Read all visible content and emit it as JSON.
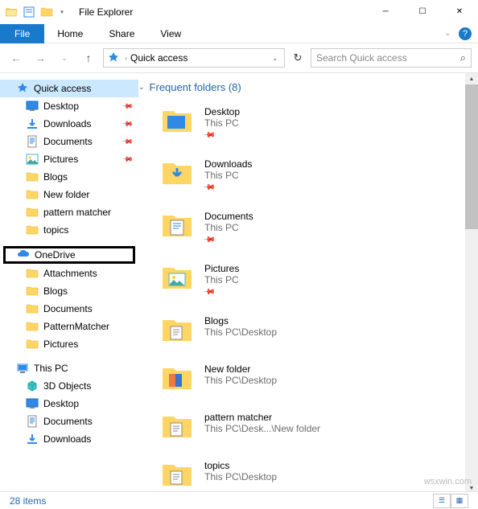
{
  "window": {
    "title": "File Explorer"
  },
  "ribbon": {
    "file": "File",
    "home": "Home",
    "share": "Share",
    "view": "View"
  },
  "address": {
    "location": "Quick access"
  },
  "search": {
    "placeholder": "Search Quick access"
  },
  "sidebar": {
    "quick_access": "Quick access",
    "items_pinned": [
      {
        "label": "Desktop",
        "icon": "desktop"
      },
      {
        "label": "Downloads",
        "icon": "downloads"
      },
      {
        "label": "Documents",
        "icon": "documents"
      },
      {
        "label": "Pictures",
        "icon": "pictures"
      }
    ],
    "items_unpinned": [
      {
        "label": "Blogs"
      },
      {
        "label": "New folder"
      },
      {
        "label": "pattern matcher"
      },
      {
        "label": "topics"
      }
    ],
    "onedrive": "OneDrive",
    "onedrive_items": [
      {
        "label": "Attachments"
      },
      {
        "label": "Blogs"
      },
      {
        "label": "Documents"
      },
      {
        "label": "PatternMatcher"
      },
      {
        "label": "Pictures"
      }
    ],
    "thispc": "This PC",
    "thispc_items": [
      {
        "label": "3D Objects",
        "icon": "3d"
      },
      {
        "label": "Desktop",
        "icon": "desktop"
      },
      {
        "label": "Documents",
        "icon": "documents"
      },
      {
        "label": "Downloads",
        "icon": "downloads"
      }
    ]
  },
  "content": {
    "section_title": "Frequent folders (8)",
    "folders": [
      {
        "name": "Desktop",
        "path": "This PC",
        "pinned": true,
        "icon": "desktop-big"
      },
      {
        "name": "Downloads",
        "path": "This PC",
        "pinned": true,
        "icon": "downloads-big"
      },
      {
        "name": "Documents",
        "path": "This PC",
        "pinned": true,
        "icon": "documents-big"
      },
      {
        "name": "Pictures",
        "path": "This PC",
        "pinned": true,
        "icon": "pictures-big"
      },
      {
        "name": "Blogs",
        "path": "This PC\\Desktop",
        "pinned": false,
        "icon": "folder-docs"
      },
      {
        "name": "New folder",
        "path": "This PC\\Desktop",
        "pinned": false,
        "icon": "folder-color"
      },
      {
        "name": "pattern matcher",
        "path": "This PC\\Desk...\\New folder",
        "pinned": false,
        "icon": "folder-docs"
      },
      {
        "name": "topics",
        "path": "This PC\\Desktop",
        "pinned": false,
        "icon": "folder-docs"
      }
    ]
  },
  "status": {
    "text": "28 items"
  },
  "watermark": "wsxwin.com"
}
